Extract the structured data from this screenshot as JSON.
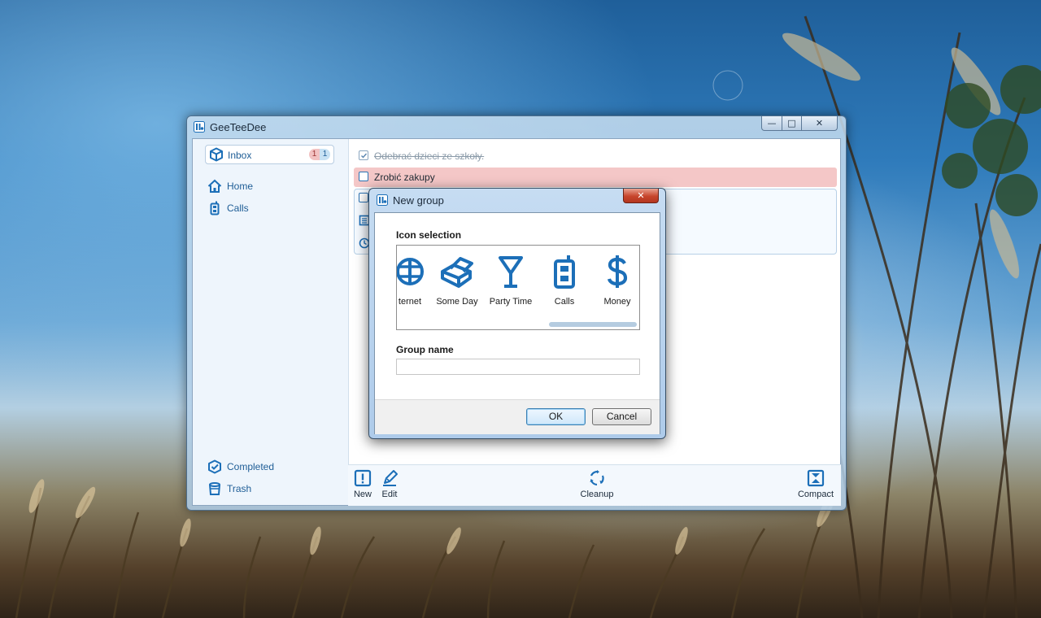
{
  "window": {
    "title": "GeeTeeDee",
    "minimize_glyph": "—",
    "maximize_glyph": "□",
    "close_glyph": "✕"
  },
  "sidebar": {
    "inbox": {
      "label": "Inbox",
      "badge_red": "1",
      "badge_blue": "1",
      "icon": "cube-icon"
    },
    "groups": [
      {
        "label": "Home",
        "icon": "home-icon"
      },
      {
        "label": "Calls",
        "icon": "phone-icon"
      }
    ],
    "bottom": [
      {
        "label": "Completed",
        "icon": "completed-icon"
      },
      {
        "label": "Trash",
        "icon": "trash-icon"
      }
    ]
  },
  "tasks": [
    {
      "text": "Odebrać dzieci ze szkoły.",
      "state": "done"
    },
    {
      "text": "Zrobić zakupy",
      "state": "selected"
    }
  ],
  "toolbar": {
    "new_label": "New",
    "edit_label": "Edit",
    "cleanup_label": "Cleanup",
    "compact_label": "Compact"
  },
  "dialog": {
    "title": "New group",
    "close_glyph": "✕",
    "icon_selection_label": "Icon selection",
    "icons": [
      {
        "label": "ternet",
        "icon": "internet-icon"
      },
      {
        "label": "Some Day",
        "icon": "box-icon"
      },
      {
        "label": "Party Time",
        "icon": "martini-icon"
      },
      {
        "label": "Calls",
        "icon": "phone-icon"
      },
      {
        "label": "Money",
        "icon": "dollar-icon"
      }
    ],
    "group_name_label": "Group name",
    "group_name_value": "",
    "ok_label": "OK",
    "cancel_label": "Cancel"
  },
  "colors": {
    "accent": "#1c6fb8",
    "selected_row": "#f4c7c7",
    "sidebar_bg": "#eef5fc"
  }
}
